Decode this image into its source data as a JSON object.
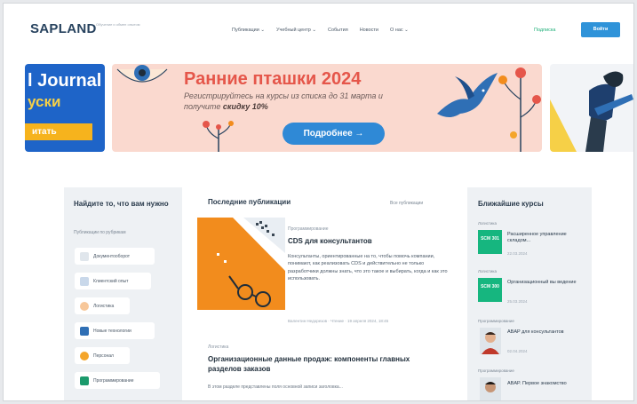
{
  "header": {
    "logo": "SAPLAND",
    "logo_tagline": "Обучение и обмен опытом",
    "nav": [
      "Публикации ⌄",
      "Учебный центр ⌄",
      "События",
      "Новости",
      "О нас ⌄"
    ],
    "register": "Подписка",
    "login": "Войти"
  },
  "banners": {
    "left": {
      "title": "l Journal",
      "subtitle": "уски",
      "button": "итать"
    },
    "main": {
      "title": "Ранние пташки 2024",
      "subtitle_line1": "Регистрируйтесь на курсы из списка до 31 марта и",
      "subtitle_line2": "получите",
      "subtitle_bold": "скидку 10%",
      "button": "Подробнее →"
    }
  },
  "left_panel": {
    "title": "Найдите то, что вам нужно",
    "subtitle": "Публикации по рубрикам",
    "pills": [
      {
        "label": "Документооборот",
        "color": "#e0e6ec"
      },
      {
        "label": "Клиентский опыт",
        "color": "#c9d8ea"
      },
      {
        "label": "Логистика",
        "color": "#f7c79a"
      },
      {
        "label": "Новые технологии",
        "color": "#2f6fb5"
      },
      {
        "label": "Персонал",
        "color": "#f4a52b"
      },
      {
        "label": "Программирование",
        "color": "#1b9a6c"
      }
    ]
  },
  "publications": {
    "title": "Последние публикации",
    "all_link": "Все публикации",
    "featured": {
      "category": "Программирование",
      "title": "CDS для консультантов",
      "text": "Консультанты, ориентированные на то, чтобы помочь компании, понимают, как реализовать CDS и действительно не только разработчики должны знать, что это такое и выбирать, когда и как это использовать.",
      "meta": "Валентин Недорезов  ·  Чтение  ·  19 апреля 2024, 18:45"
    },
    "second": {
      "category": "Логистика",
      "title": "Организационные данные продаж: компоненты главных разделов заказов",
      "text": "В этом разделе представлены поля основной записи заголовка..."
    }
  },
  "right_panel": {
    "title": "Ближайшие курсы",
    "courses": [
      {
        "category": "Логистика",
        "badge": "SCM 301",
        "title": "Расширенное управление складом...",
        "date": "22.03.2024"
      },
      {
        "category": "Логистика",
        "badge": "SCM 300",
        "title": "Организационный вы ведение",
        "date": "25.03.2024"
      },
      {
        "category": "Программирование",
        "badge": "",
        "title": "ABAP для консультантов",
        "date": "02.04.2024"
      },
      {
        "category": "Программирование",
        "badge": "",
        "title": "ABAP. Первое знакомство",
        "date": ""
      }
    ]
  },
  "colors": {
    "accent_blue": "#2f93d9",
    "brand_green": "#16b67f",
    "banner_pink": "#fad9cf",
    "banner_title": "#e5564a"
  }
}
